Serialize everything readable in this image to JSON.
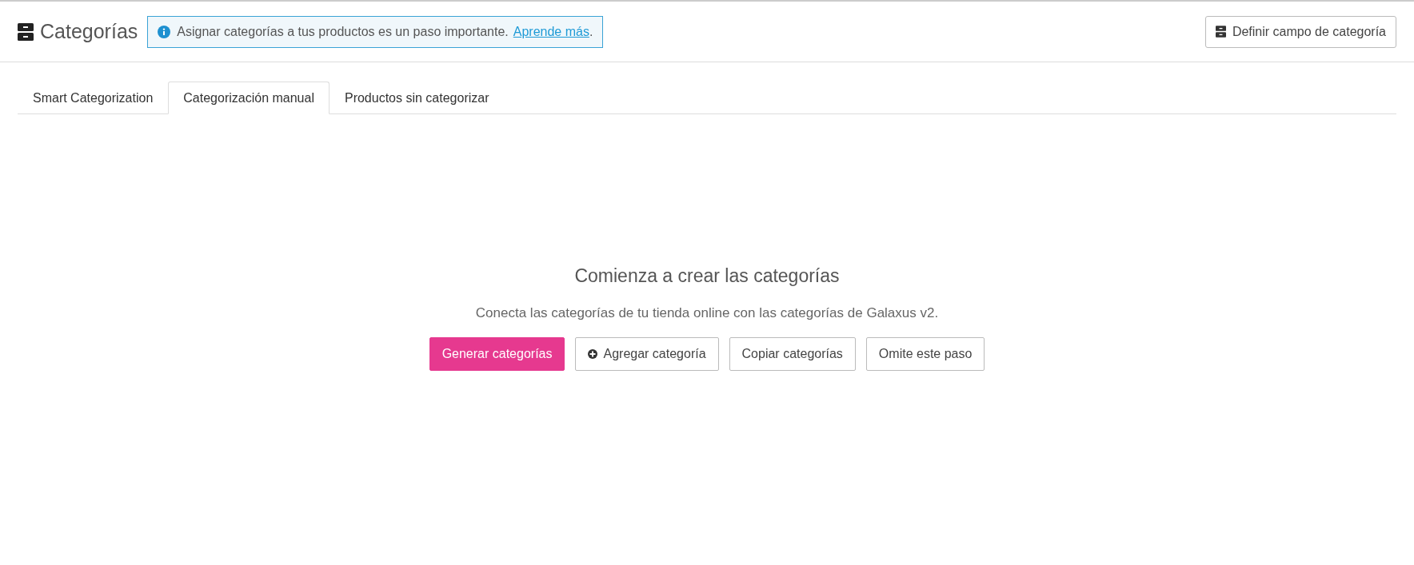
{
  "header": {
    "title": "Categorías",
    "notice": {
      "text": "Asignar categorías a tus productos es un paso importante.",
      "link": "Aprende más",
      "after": "."
    },
    "action": "Definir campo de categoría"
  },
  "tabs": [
    {
      "label": "Smart Categorization",
      "selected": false
    },
    {
      "label": "Categorización manual",
      "selected": true
    },
    {
      "label": "Productos sin categorizar",
      "selected": false
    }
  ],
  "empty_state": {
    "heading": "Comienza a crear las categorías",
    "text": "Conecta las categorías de tu tienda online con las categorías de Galaxus v2.",
    "buttons": [
      {
        "label": "Generar categorías",
        "kind": "primary"
      },
      {
        "label": "Agregar categoría",
        "kind": "add"
      },
      {
        "label": "Copiar categorías",
        "kind": "default"
      },
      {
        "label": "Omite este paso",
        "kind": "default"
      }
    ]
  }
}
